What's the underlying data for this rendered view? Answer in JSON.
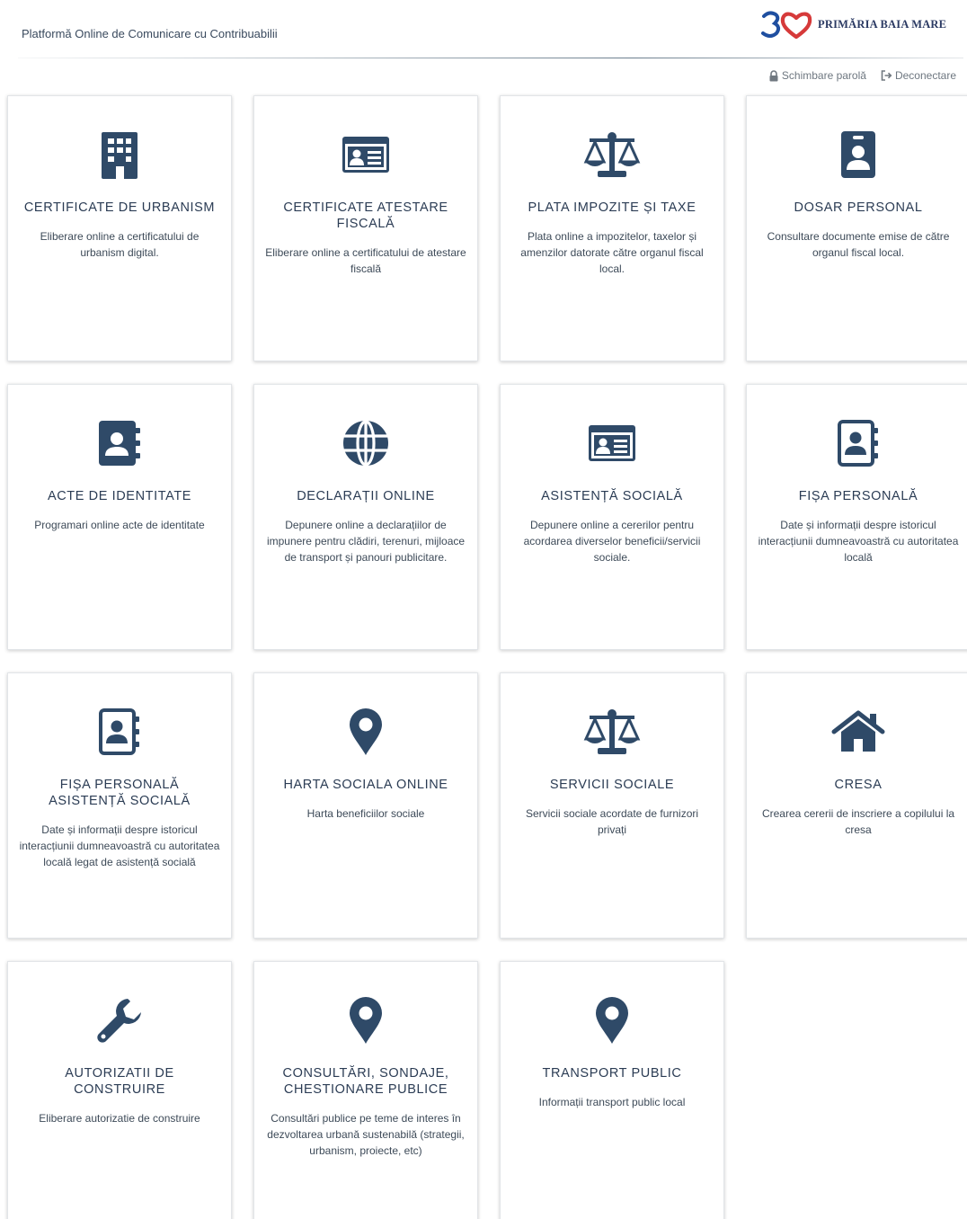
{
  "header": {
    "platform_title": "Platformă Online de Comunicare cu Contribuabilii",
    "logo_text": "PRIMĂRIA BAIA MARE",
    "logo_mark": "heart-30-logo"
  },
  "userbar": {
    "change_password": "Schimbare parolă",
    "logout": "Deconectare"
  },
  "colors": {
    "icon": "#2f4a68",
    "title": "#2b3c54",
    "logo_blue": "#1f4fa0",
    "logo_red": "#d63a3a"
  },
  "cards": [
    {
      "icon": "building-icon",
      "title": "CERTIFICATE DE URBANISM",
      "desc": "Eliberare online a certificatului de urbanism digital."
    },
    {
      "icon": "id-card-icon",
      "title": "CERTIFICATE ATESTARE FISCALĂ",
      "desc": "Eliberare online a certificatului de atestare fiscală"
    },
    {
      "icon": "scale-icon",
      "title": "PLATA IMPOZITE ȘI TAXE",
      "desc": "Plata online a impozitelor, taxelor și amenzilor datorate către organul fiscal local."
    },
    {
      "icon": "id-badge-icon",
      "title": "DOSAR PERSONAL",
      "desc": "Consultare documente emise de către organul fiscal local."
    },
    {
      "icon": "address-book-icon",
      "title": "ACTE DE IDENTITATE",
      "desc": "Programari online acte de identitate"
    },
    {
      "icon": "globe-icon",
      "title": "DECLARAȚII ONLINE",
      "desc": "Depunere online a declarațiilor de impunere pentru clădiri, terenuri, mijloace de transport și panouri publicitare."
    },
    {
      "icon": "id-card-icon",
      "title": "ASISTENȚĂ SOCIALĂ",
      "desc": "Depunere online a cererilor pentru acordarea diverselor beneficii/servicii sociale."
    },
    {
      "icon": "address-book-outline-icon",
      "title": "FIȘA PERSONALĂ",
      "desc": "Date și informații despre istoricul interacțiunii dumneavoastră cu autoritatea locală"
    },
    {
      "icon": "address-book-outline-icon",
      "title": "FIȘA PERSONALĂ ASISTENȚĂ SOCIALĂ",
      "desc": "Date și informații despre istoricul interacțiunii dumneavoastră cu autoritatea locală legat de asistență socială"
    },
    {
      "icon": "map-marker-icon",
      "title": "HARTA SOCIALA ONLINE",
      "desc": "Harta beneficiilor sociale"
    },
    {
      "icon": "scale-icon",
      "title": "SERVICII SOCIALE",
      "desc": "Servicii sociale acordate de furnizori privați"
    },
    {
      "icon": "home-icon",
      "title": "CRESA",
      "desc": "Crearea cererii de inscriere a copilului la cresa"
    },
    {
      "icon": "wrench-icon",
      "title": "AUTORIZATII DE CONSTRUIRE",
      "desc": "Eliberare autorizatie de construire"
    },
    {
      "icon": "map-marker-icon",
      "title": "CONSULTĂRI, SONDAJE, CHESTIONARE PUBLICE",
      "desc": "Consultări publice pe teme de interes în dezvoltarea urbană sustenabilă (strategii, urbanism, proiecte, etc)"
    },
    {
      "icon": "map-marker-icon",
      "title": "TRANSPORT PUBLIC",
      "desc": "Informații transport public local"
    }
  ]
}
